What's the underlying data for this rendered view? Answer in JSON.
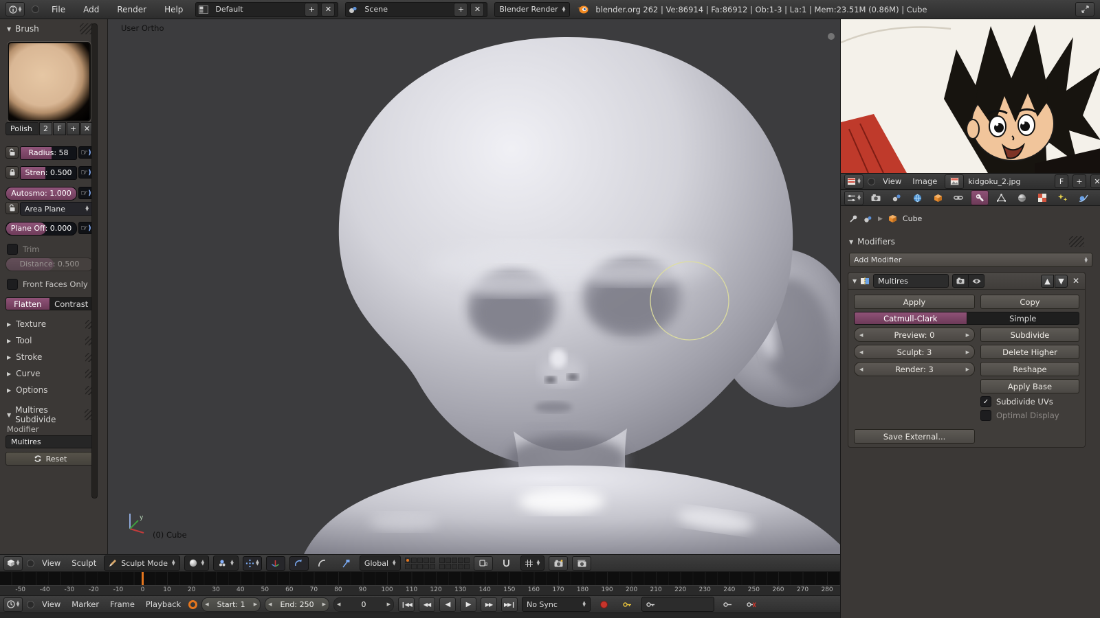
{
  "topbar": {
    "menus": [
      "File",
      "Add",
      "Render",
      "Help"
    ],
    "layout": "Default",
    "scene": "Scene",
    "engine": "Blender Render",
    "stats": "blender.org 262 | Ve:86914 | Fa:86912 | Ob:1-3 | La:1 | Mem:23.51M (0.86M) | Cube"
  },
  "toolshelf": {
    "brush_panel": "Brush",
    "brush_name": "Polish",
    "users": "2",
    "fake_user": "F",
    "radius": "Radius: 58",
    "strength": "Stren: 0.500",
    "autosmooth": "Autosmo: 1.000",
    "area_plane": "Area Plane",
    "plane_offset": "Plane Off: 0.000",
    "trim": "Trim",
    "distance": "Distance: 0.500",
    "front_faces": "Front Faces Only",
    "flatten": "Flatten",
    "contrast": "Contrast",
    "sections": [
      "Texture",
      "Tool",
      "Stroke",
      "Curve",
      "Options"
    ],
    "multires_panel": "Multires Subdivide",
    "modifier_label": "Modifier",
    "modifier_name": "Multires",
    "reset": "Reset"
  },
  "viewport": {
    "view": "User Ortho",
    "object": "(0) Cube",
    "menus": [
      "View",
      "Sculpt"
    ],
    "mode": "Sculpt Mode",
    "orientation": "Global",
    "axis_label": "y"
  },
  "timeline": {
    "menus": [
      "View",
      "Marker",
      "Frame",
      "Playback"
    ],
    "start": "Start: 1",
    "end": "End: 250",
    "frame": "0",
    "sync": "No Sync",
    "ticks": [
      "-50",
      "-40",
      "-30",
      "-20",
      "-10",
      "0",
      "10",
      "20",
      "30",
      "40",
      "50",
      "60",
      "70",
      "80",
      "90",
      "100",
      "110",
      "120",
      "130",
      "140",
      "150",
      "160",
      "170",
      "180",
      "190",
      "200",
      "210",
      "220",
      "230",
      "240",
      "250",
      "260",
      "270",
      "280"
    ]
  },
  "image_editor": {
    "menus": [
      "View",
      "Image"
    ],
    "filename": "kidgoku_2.jpg",
    "fake_user": "F"
  },
  "properties": {
    "object": "Cube",
    "panel": "Modifiers",
    "add_modifier": "Add Modifier",
    "name": "Multires",
    "apply": "Apply",
    "copy": "Copy",
    "catmull_clark": "Catmull-Clark",
    "simple": "Simple",
    "preview": "Preview: 0",
    "subdivide": "Subdivide",
    "sculpt": "Sculpt: 3",
    "delete_higher": "Delete Higher",
    "render": "Render: 3",
    "reshape": "Reshape",
    "apply_base": "Apply Base",
    "subdivide_uvs": "Subdivide UVs",
    "optimal_display": "Optimal Display",
    "save_external": "Save External..."
  },
  "colors": {
    "accent_purple": "#8f5277",
    "cursor_orange": "#e5761e",
    "object_orange": "#e88c2e"
  }
}
